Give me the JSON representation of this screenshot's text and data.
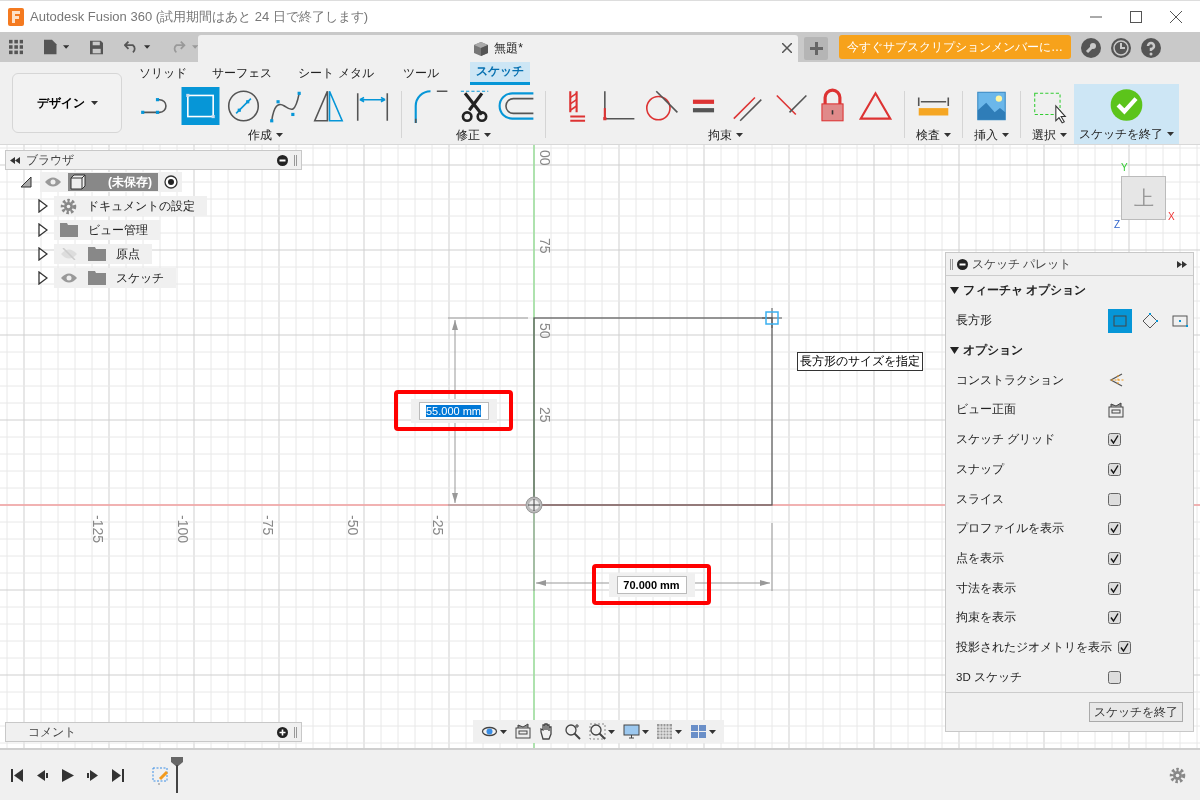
{
  "window": {
    "title": "Autodesk Fusion 360 (試用期間はあと 24 日で終了します)"
  },
  "document_tab": {
    "title": "無題*"
  },
  "subscribe_button": {
    "label": "今すぐサブスクリプションメンバーに…"
  },
  "workspace_button": {
    "label": "デザイン"
  },
  "ribbon_tabs": [
    {
      "label": "ソリッド",
      "selected": false
    },
    {
      "label": "サーフェス",
      "selected": false
    },
    {
      "label": "シート メタル",
      "selected": false
    },
    {
      "label": "ツール",
      "selected": false
    },
    {
      "label": "スケッチ",
      "selected": true
    }
  ],
  "tool_groups": [
    {
      "label": "作成",
      "highlighted": false,
      "tools": [
        {
          "kind": "line",
          "selected": false
        },
        {
          "kind": "rectangle",
          "selected": true
        },
        {
          "kind": "circle",
          "selected": false
        },
        {
          "kind": "spline",
          "selected": false
        },
        {
          "kind": "mirror",
          "selected": false
        },
        {
          "kind": "dimension",
          "selected": false
        }
      ]
    },
    {
      "label": "修正",
      "highlighted": false,
      "tools": [
        {
          "kind": "fillet",
          "selected": false
        },
        {
          "kind": "trim",
          "selected": false
        },
        {
          "kind": "offset",
          "selected": false
        }
      ]
    },
    {
      "label": "拘束",
      "highlighted": false,
      "tools": [
        {
          "kind": "ground",
          "selected": false
        },
        {
          "kind": "corner",
          "selected": false
        },
        {
          "kind": "tangent",
          "selected": false
        },
        {
          "kind": "equal",
          "selected": false
        },
        {
          "kind": "parallel",
          "selected": false
        },
        {
          "kind": "perpendicular",
          "selected": false
        },
        {
          "kind": "lock",
          "selected": false
        },
        {
          "kind": "triangle",
          "selected": false
        }
      ]
    },
    {
      "label": "検査",
      "highlighted": false,
      "tools": [
        {
          "kind": "ruler",
          "selected": false
        }
      ]
    },
    {
      "label": "挿入",
      "highlighted": false,
      "tools": [
        {
          "kind": "image",
          "selected": false
        }
      ]
    },
    {
      "label": "選択",
      "highlighted": false,
      "tools": [
        {
          "kind": "select",
          "selected": false
        }
      ]
    },
    {
      "label": "スケッチを終了",
      "highlighted": true,
      "tools": [
        {
          "kind": "finish",
          "selected": false
        }
      ]
    }
  ],
  "browser": {
    "title": "ブラウザ",
    "root": {
      "label": "(未保存)",
      "visible": true,
      "expanded": true,
      "children": [
        {
          "label": "ドキュメントの設定",
          "kind": "settings",
          "expanded": false
        },
        {
          "label": "ビュー管理",
          "kind": "folder",
          "expanded": false
        },
        {
          "label": "原点",
          "kind": "folder",
          "visible": false,
          "expanded": false
        },
        {
          "label": "スケッチ",
          "kind": "folder",
          "visible": true,
          "expanded": false
        }
      ]
    }
  },
  "canvas": {
    "y_axis_labels": [
      "00",
      "75",
      "50",
      "25"
    ],
    "x_axis_labels": [
      "-125",
      "-100",
      "-75",
      "-50",
      "-25"
    ],
    "dimension_inputs": [
      {
        "value": "55.000 mm",
        "focused": true,
        "highlighted": true
      },
      {
        "value": "70.000 mm",
        "focused": false,
        "highlighted": true
      }
    ],
    "tooltip": "長方形のサイズを指定",
    "view_cube": {
      "face": "上",
      "axis_y": "Y",
      "axis_x": "X",
      "axis_z": "Z"
    }
  },
  "sketch_palette": {
    "title": "スケッチ パレット",
    "sections": [
      {
        "title": "フィーチャ オプション",
        "expanded": true,
        "rows": [
          {
            "label": "長方形",
            "kind": "choice",
            "options": [
              {
                "selected": true
              },
              {
                "selected": false
              },
              {
                "selected": false
              }
            ]
          }
        ]
      },
      {
        "title": "オプション",
        "expanded": true,
        "rows": [
          {
            "label": "コンストラクション",
            "kind": "construction"
          },
          {
            "label": "ビュー正面",
            "kind": "lookat"
          },
          {
            "label": "スケッチ グリッド",
            "kind": "checkbox",
            "checked": true
          },
          {
            "label": "スナップ",
            "kind": "checkbox",
            "checked": true
          },
          {
            "label": "スライス",
            "kind": "checkbox",
            "checked": false
          },
          {
            "label": "プロファイルを表示",
            "kind": "checkbox",
            "checked": true
          },
          {
            "label": "点を表示",
            "kind": "checkbox",
            "checked": true
          },
          {
            "label": "寸法を表示",
            "kind": "checkbox",
            "checked": true
          },
          {
            "label": "拘束を表示",
            "kind": "checkbox",
            "checked": true
          },
          {
            "label": "投影されたジオメトリを表示",
            "kind": "checkbox",
            "checked": true
          },
          {
            "label": "3D スケッチ",
            "kind": "checkbox",
            "checked": false
          }
        ]
      }
    ],
    "finish_button": "スケッチを終了"
  },
  "comments": {
    "title": "コメント"
  }
}
